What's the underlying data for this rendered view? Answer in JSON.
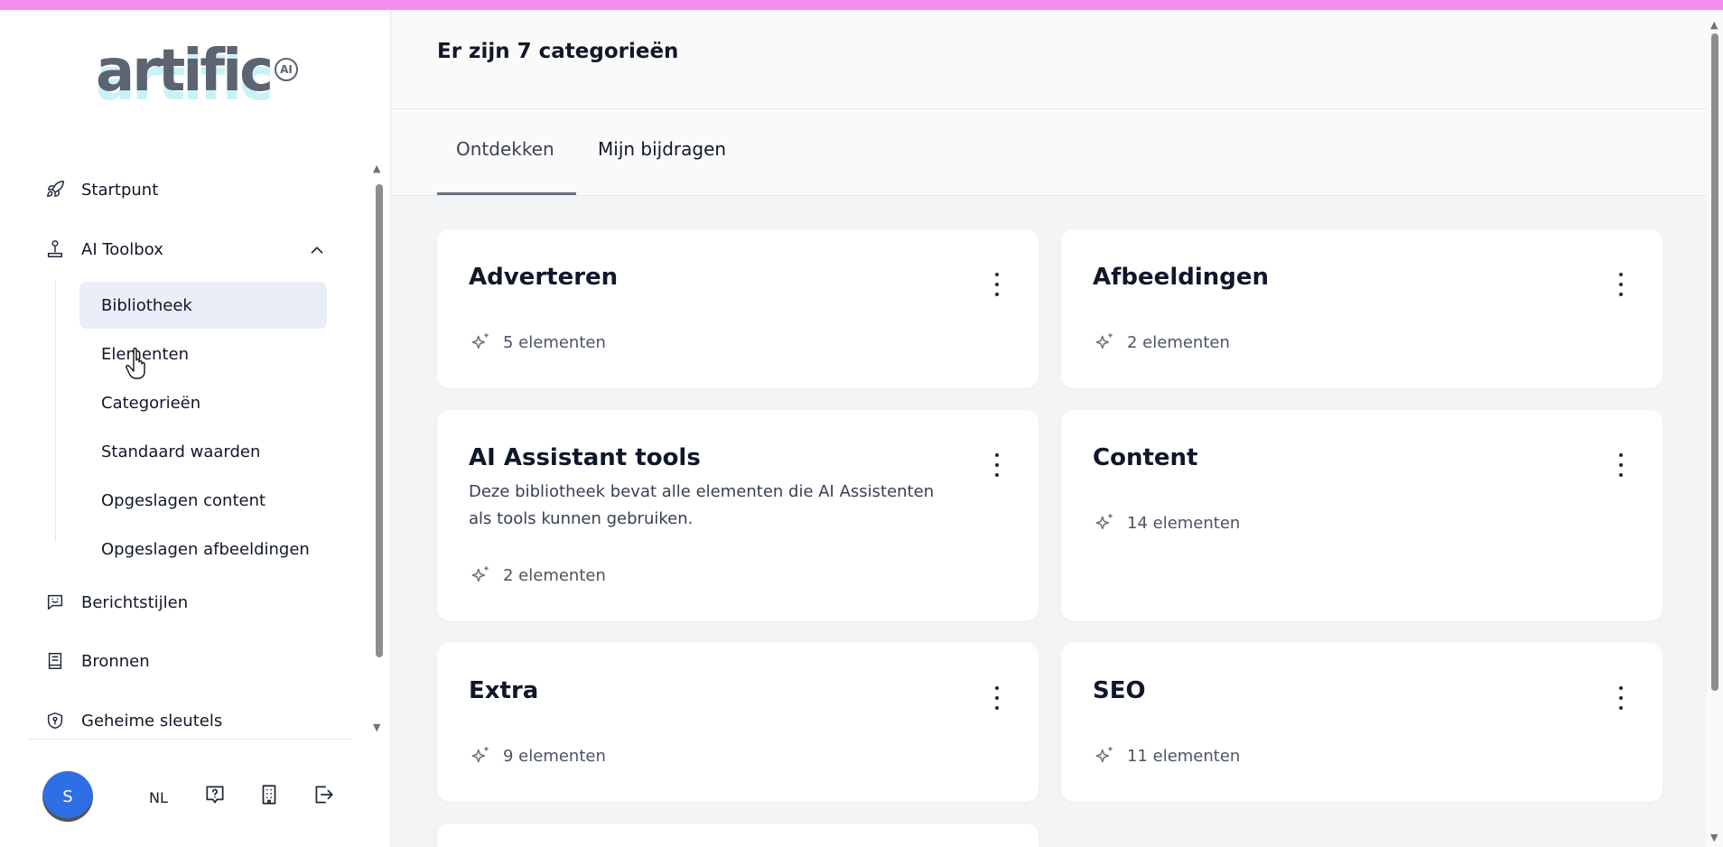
{
  "app": {
    "logo_text": "artific",
    "logo_badge": "AI"
  },
  "colors": {
    "accent_bar": "#f48cf0",
    "active_nav_bg": "#e9eef8",
    "avatar_bg": "#2f6fe6"
  },
  "sidebar": {
    "items": [
      {
        "label": "Startpunt",
        "icon": "rocket-icon"
      },
      {
        "label": "AI Toolbox",
        "icon": "joystick-icon",
        "expanded": true
      },
      {
        "label": "Berichtstijlen",
        "icon": "chat-smile-icon"
      },
      {
        "label": "Bronnen",
        "icon": "book-icon"
      },
      {
        "label": "Geheime sleutels",
        "icon": "shield-key-icon"
      }
    ],
    "toolbox_subitems": [
      {
        "label": "Bibliotheek",
        "active": true
      },
      {
        "label": "Elementen"
      },
      {
        "label": "Categorieën"
      },
      {
        "label": "Standaard waarden"
      },
      {
        "label": "Opgeslagen content"
      },
      {
        "label": "Opgeslagen afbeeldingen"
      }
    ]
  },
  "footer": {
    "avatar_initial": "S",
    "language": "NL",
    "icons": [
      "help-icon",
      "building-icon",
      "logout-icon"
    ]
  },
  "header": {
    "title": "Er zijn 7 categorieën"
  },
  "tabs": [
    {
      "label": "Ontdekken",
      "active": true
    },
    {
      "label": "Mijn bijdragen"
    }
  ],
  "categories": [
    {
      "title": "Adverteren",
      "description": "",
      "count": "5 elementen"
    },
    {
      "title": "Afbeeldingen",
      "description": "",
      "count": "2 elementen"
    },
    {
      "title": "AI Assistant tools",
      "description": "Deze bibliotheek bevat alle elementen die AI Assistenten als tools kunnen gebruiken.",
      "count": "2 elementen"
    },
    {
      "title": "Content",
      "description": "",
      "count": "14 elementen"
    },
    {
      "title": "Extra",
      "description": "",
      "count": "9 elementen"
    },
    {
      "title": "SEO",
      "description": "",
      "count": "11 elementen"
    }
  ]
}
